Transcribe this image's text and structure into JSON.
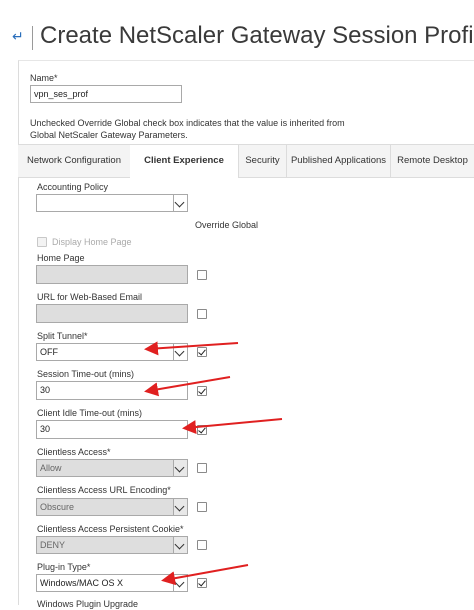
{
  "header": {
    "back_icon": "back-arrow-icon",
    "title": "Create NetScaler Gateway Session Profile"
  },
  "form": {
    "name_label": "Name*",
    "name_value": "vpn_ses_prof",
    "override_note": "Unchecked Override Global check box indicates that the value is inherited from Global NetScaler Gateway Parameters."
  },
  "tabs": [
    {
      "label": "Network Configuration",
      "active": false
    },
    {
      "label": "Client Experience",
      "active": true
    },
    {
      "label": "Security",
      "active": false
    },
    {
      "label": "Published Applications",
      "active": false
    },
    {
      "label": "Remote Desktop",
      "active": false
    }
  ],
  "client_experience": {
    "accounting_policy_label": "Accounting Policy",
    "accounting_policy_value": "",
    "override_global_label": "Override Global",
    "display_home_page_label": "Display Home Page",
    "home_page_label": "Home Page",
    "home_page_value": "",
    "url_email_label": "URL for Web-Based Email",
    "url_email_value": "",
    "split_tunnel_label": "Split Tunnel*",
    "split_tunnel_value": "OFF",
    "session_timeout_label": "Session Time-out (mins)",
    "session_timeout_value": "30",
    "client_idle_label": "Client Idle Time-out (mins)",
    "client_idle_value": "30",
    "clientless_access_label": "Clientless Access*",
    "clientless_access_value": "Allow",
    "clientless_url_label": "Clientless Access URL Encoding*",
    "clientless_url_value": "Obscure",
    "clientless_cookie_label": "Clientless Access Persistent Cookie*",
    "clientless_cookie_value": "DENY",
    "plugin_type_label": "Plug-in Type*",
    "plugin_type_value": "Windows/MAC OS X",
    "next_label_partial": "Windows Plugin Upgrade"
  },
  "override_checkboxes": {
    "home_page": false,
    "url_email": false,
    "split_tunnel": true,
    "session_timeout": true,
    "client_idle": true,
    "clientless_access": false,
    "clientless_url": false,
    "clientless_cookie": false,
    "plugin_type": true
  },
  "colors": {
    "accent": "#2a6ebb",
    "annotation_arrow": "#e02020",
    "tab_bar": "#f4f4f4"
  }
}
